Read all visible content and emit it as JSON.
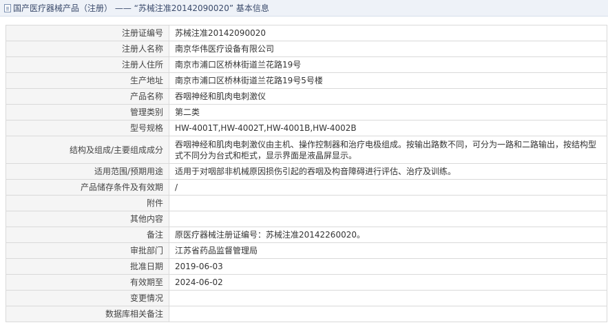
{
  "header": {
    "title": "国产医疗器械产品（注册） —— “苏械注准20142090020” 基本信息"
  },
  "rows": [
    {
      "label": "注册证编号",
      "value": "苏械注准20142090020"
    },
    {
      "label": "注册人名称",
      "value": "南京华伟医疗设备有限公司"
    },
    {
      "label": "注册人住所",
      "value": "南京市浦口区桥林街道兰花路19号"
    },
    {
      "label": "生产地址",
      "value": "南京市浦口区桥林街道兰花路19号5号楼"
    },
    {
      "label": "产品名称",
      "value": "吞咽神经和肌肉电刺激仪"
    },
    {
      "label": "管理类别",
      "value": "第二类"
    },
    {
      "label": "型号规格",
      "value": "HW-4001T,HW-4002T,HW-4001B,HW-4002B"
    },
    {
      "label": "结构及组成/主要组成成分",
      "value": "吞咽神经和肌肉电刺激仪由主机、操作控制器和治疗电极组成。按输出路数不同，可分为一路和二路输出，按结构型式不同分为台式和柜式，显示界面是液晶屏显示。"
    },
    {
      "label": "适用范围/预期用途",
      "value": "适用于对咽部非机械原因损伤引起的吞咽及构音障碍进行评估、治疗及训练。"
    },
    {
      "label": "产品储存条件及有效期",
      "value": "/"
    },
    {
      "label": "附件",
      "value": ""
    },
    {
      "label": "其他内容",
      "value": ""
    },
    {
      "label": "备注",
      "value": "原医疗器械注册证编号：苏械注准20142260020。"
    },
    {
      "label": "审批部门",
      "value": "江苏省药品监督管理局"
    },
    {
      "label": "批准日期",
      "value": "2019-06-03"
    },
    {
      "label": "有效期至",
      "value": "2024-06-02"
    },
    {
      "label": "变更情况",
      "value": ""
    },
    {
      "label": "数据库相关备注",
      "value": ""
    }
  ]
}
